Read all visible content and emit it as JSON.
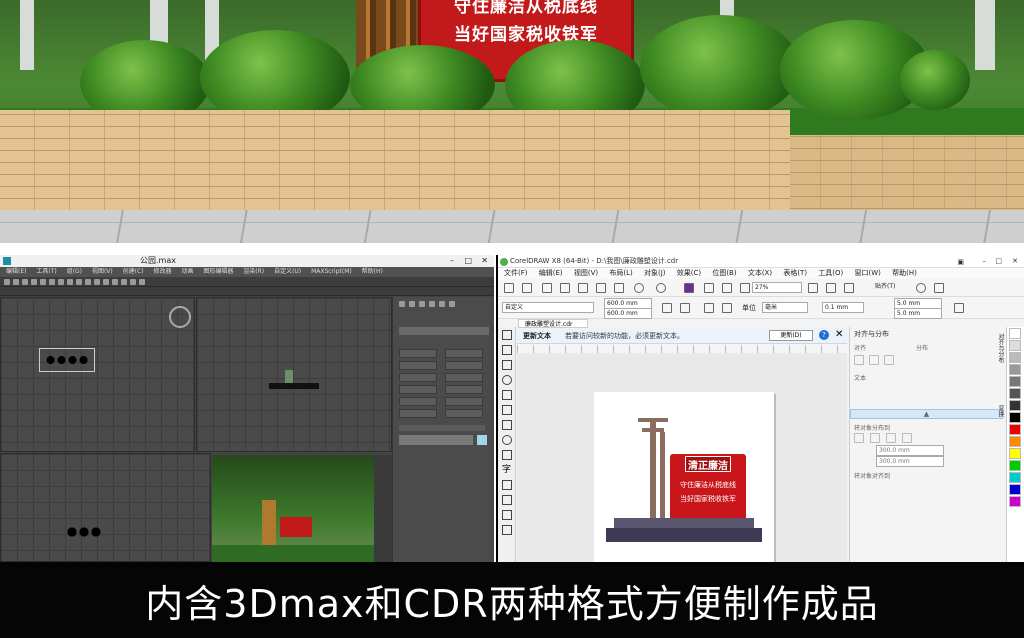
{
  "scene": {
    "sign_line_top": "守住廉洁从税底线",
    "sign_line_bottom": "当好国家税收铁军"
  },
  "max": {
    "window_title": "公园.max",
    "menu": [
      "编辑(E)",
      "工具(T)",
      "组(G)",
      "视图(V)",
      "创建(C)",
      "修改器",
      "动画",
      "图形编辑器",
      "渲染(R)",
      "自定义(U)",
      "MAXScript(M)",
      "帮助(H)"
    ]
  },
  "cdr": {
    "window_title": "CorelDRAW X8 (64-Bit) - D:\\我图\\廉政雕塑设计.cdr",
    "menu": [
      "文件(F)",
      "编辑(E)",
      "视图(V)",
      "布局(L)",
      "对象(J)",
      "效果(C)",
      "位图(B)",
      "文本(X)",
      "表格(T)",
      "工具(O)",
      "窗口(W)",
      "帮助(H)"
    ],
    "zoom": "27%",
    "snap_label": "贴齐(T)",
    "page_preset": "自定义",
    "width": "600.0 mm",
    "height": "600.0 mm",
    "unit_label": "单位",
    "unit": "毫米",
    "nudge": "0.1 mm",
    "dup_x": "5.0 mm",
    "dup_y": "5.0 mm",
    "doc_tab": "廉政雕塑设计.cdr",
    "update_label": "更新文本",
    "update_message": "若要访问较新的功能，必须更新文本。",
    "update_button": "更新(D)",
    "panel_title": "对齐与分布",
    "panel_align": "对齐",
    "panel_distribute": "分布",
    "panel_text": "文本",
    "panel_spacing": "将对象分布到",
    "panel_x": "300.0 mm",
    "panel_y": "300.0 mm",
    "panel_margin": "将对象对齐到",
    "tab_align": "对齐与分布",
    "tab_change": "变换",
    "sculpture_title": "清正廉洁",
    "sculpture_line1": "守住廉洁从税底线",
    "sculpture_line2": "当好国家税收铁军"
  },
  "caption": "内含3Dmax和CDR两种格式方便制作成品"
}
